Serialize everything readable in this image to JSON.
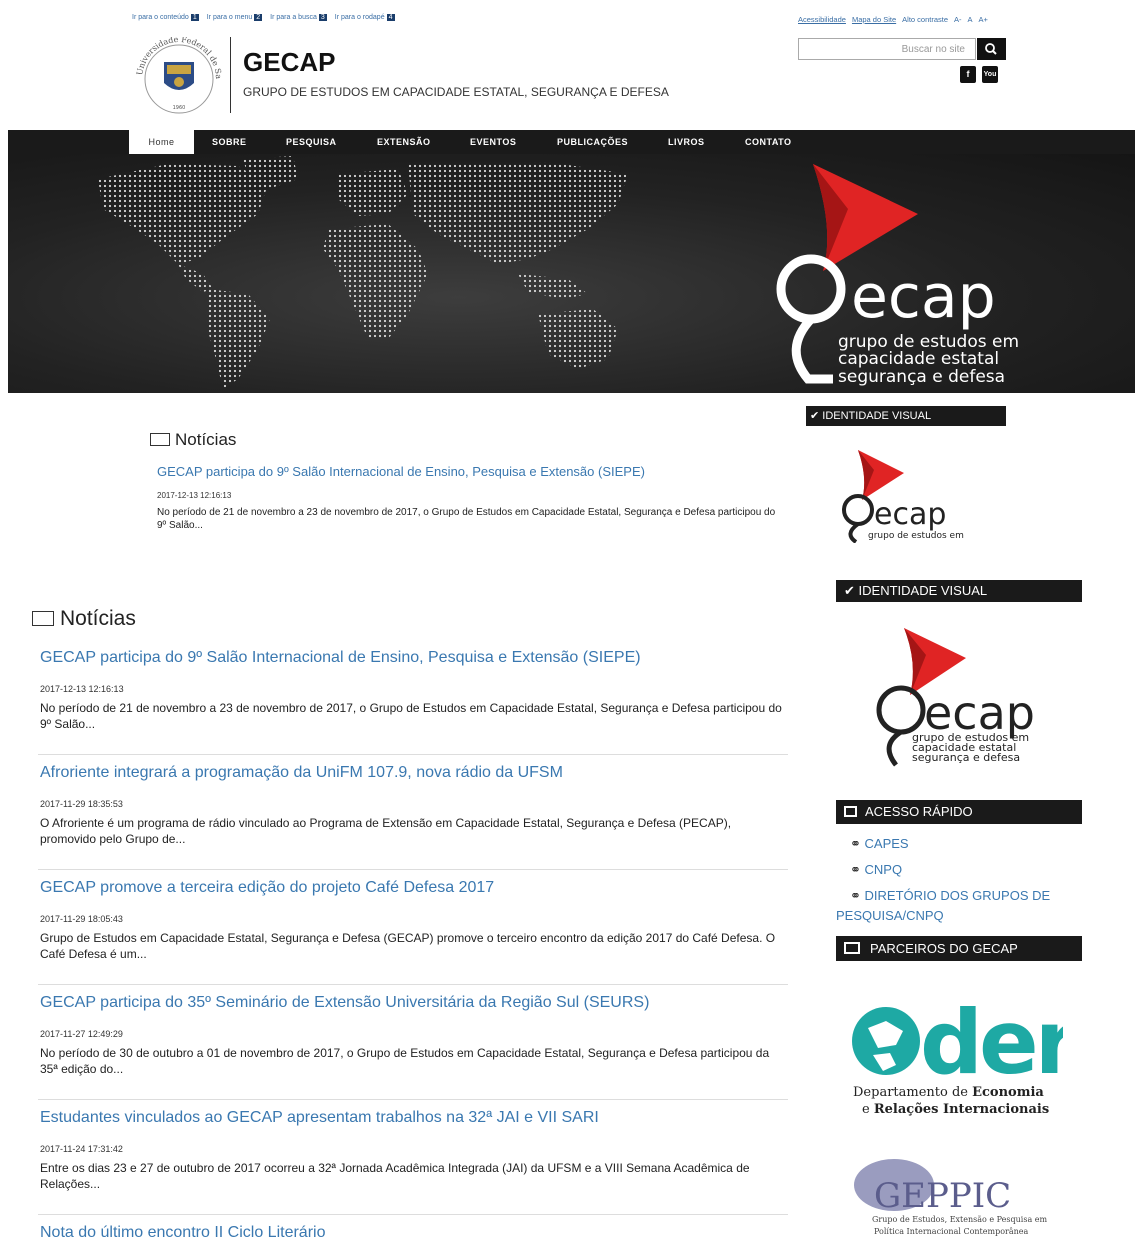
{
  "accessibility": {
    "skip_links": [
      {
        "label": "Ir para o conteúdo",
        "key": "1"
      },
      {
        "label": "Ir para o menu",
        "key": "2"
      },
      {
        "label": "Ir para a busca",
        "key": "3"
      },
      {
        "label": "Ir para o rodapé",
        "key": "4"
      }
    ],
    "acessibilidade": "Acessibilidade",
    "mapa": "Mapa do Site",
    "contraste": "Alto contraste",
    "font_minus": "A-",
    "font_normal": "A",
    "font_plus": "A+"
  },
  "header": {
    "title": "GECAP",
    "subtitle": "GRUPO DE ESTUDOS EM CAPACIDADE ESTATAL, SEGURANÇA E DEFESA",
    "seal_year": "1960",
    "seal_text": "Universidade Federal de Santa Maria"
  },
  "search": {
    "placeholder": "Buscar no site"
  },
  "social": [
    {
      "icon": "facebook-icon",
      "label": "f"
    },
    {
      "icon": "youtube-icon",
      "label": "You"
    }
  ],
  "nav": [
    "Home",
    "SOBRE",
    "PESQUISA",
    "EXTENSÃO",
    "EVENTOS",
    "PUBLICAÇÕES",
    "LIVROS",
    "CONTATO"
  ],
  "banner": {
    "logo_word": "ecap",
    "tagline": [
      "grupo de estudos em",
      "capacidade estatal",
      "segurança e defesa"
    ]
  },
  "small_news": {
    "heading": "Notícias",
    "title": "GECAP participa do 9º Salão Internacional de Ensino, Pesquisa e Extensão (SIEPE)",
    "date": "2017-12-13 12:16:13",
    "excerpt": "No período de 21 de novembro a 23 de novembro de 2017, o Grupo de Estudos em Capacidade Estatal, Segurança e Defesa participou do 9º Salão..."
  },
  "news": {
    "heading": "Notícias",
    "items": [
      {
        "title": "GECAP participa do 9º Salão Internacional de Ensino, Pesquisa e Extensão (SIEPE)",
        "date": "2017-12-13 12:16:13",
        "excerpt": "No período de 21 de novembro a 23 de novembro de 2017, o Grupo de Estudos em Capacidade Estatal, Segurança e Defesa participou do 9º Salão..."
      },
      {
        "title": "Afroriente integrará a programação da UniFM 107.9, nova rádio da UFSM",
        "date": "2017-11-29 18:35:53",
        "excerpt": "O Afroriente é um programa de rádio vinculado ao Programa de Extensão em Capacidade Estatal, Segurança e Defesa (PECAP), promovido pelo Grupo de..."
      },
      {
        "title": "GECAP promove a terceira edição do projeto Café Defesa 2017",
        "date": "2017-11-29 18:05:43",
        "excerpt": "Grupo de Estudos em Capacidade Estatal, Segurança e Defesa (GECAP) promove o terceiro encontro da edição 2017 do Café Defesa. O Café Defesa é um..."
      },
      {
        "title": "GECAP participa do 35º Seminário de Extensão Universitária da Região Sul (SEURS)",
        "date": "2017-11-27 12:49:29",
        "excerpt": "No período de 30 de outubro a 01 de novembro de 2017, o Grupo de Estudos em Capacidade Estatal, Segurança e Defesa participou da 35ª edição do..."
      },
      {
        "title": "Estudantes vinculados ao GECAP apresentam trabalhos na 32ª JAI e VII SARI",
        "date": "2017-11-24 17:31:42",
        "excerpt": "Entre os dias 23 e 27 de outubro de 2017 ocorreu a 32ª Jornada Acadêmica Integrada (JAI) da UFSM e a VIII Semana Acadêmica de Relações..."
      },
      {
        "title": "Nota do último encontro II Ciclo Literário"
      }
    ]
  },
  "sidebar": {
    "identidade_small": "IDENTIDADE VISUAL",
    "identidade_small_logo": {
      "word": "ecap",
      "tag": "grupo de estudos em"
    },
    "identidade": "IDENTIDADE VISUAL",
    "identidade_logo": {
      "word": "ecap",
      "tag": [
        "grupo de estudos em",
        "capacidade estatal",
        "segurança e defesa"
      ]
    },
    "acesso": "ACESSO RÁPIDO",
    "links": [
      "CAPES",
      "CNPQ",
      "DIRETÓRIO DOS GRUPOS DE",
      "PESQUISA/CNPQ"
    ],
    "parceiros": "PARCEIROS DO GECAP",
    "deri": {
      "word": "deri",
      "line1": "Departamento de",
      "line1b": "Economia",
      "line2": "e",
      "line2b": "Relações Internacionais"
    },
    "geppic": {
      "word": "GEPPIC",
      "line1": "Grupo de Estudos, Extensão e Pesquisa em",
      "line2": "Política Internacional Contemporânea"
    }
  }
}
